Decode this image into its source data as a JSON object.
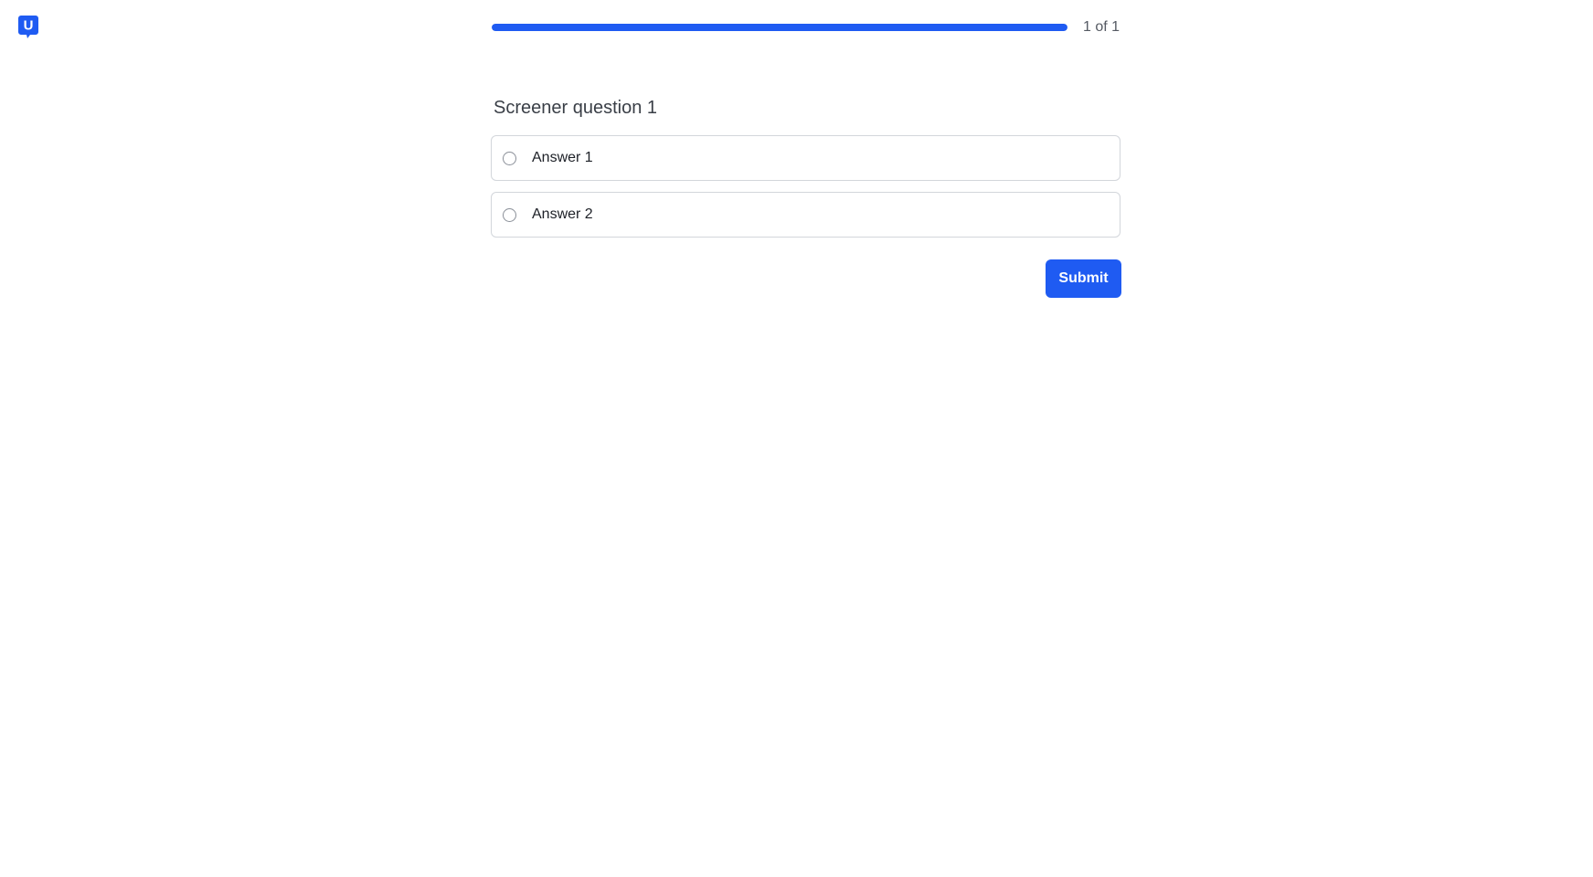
{
  "brand": {
    "logo_letter": "U",
    "logo_icon": "speech-bubble-u-icon",
    "accent_color": "#1f5bf2"
  },
  "progress": {
    "text": "1 of 1",
    "fraction": 1.0
  },
  "question": {
    "title": "Screener question 1",
    "options": [
      {
        "label": "Answer 1",
        "selected": false
      },
      {
        "label": "Answer 2",
        "selected": false
      }
    ]
  },
  "actions": {
    "submit_label": "Submit"
  }
}
